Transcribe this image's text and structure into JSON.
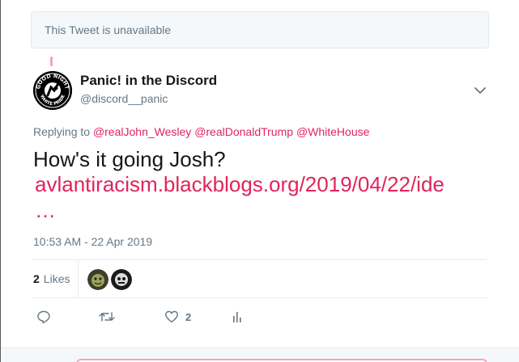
{
  "unavailable_notice": "This Tweet is unavailable",
  "author": {
    "name": "Panic! in the Discord",
    "handle": "@discord__panic",
    "avatar_icon": "good-night-white-pride-logo",
    "avatar_text_top": "GOOD NIGHT",
    "avatar_text_bottom": "WHITE PRIDE"
  },
  "replying": {
    "prefix": "Replying to",
    "mentions": [
      "@realJohn_Wesley",
      "@realDonaldTrump",
      "@WhiteHouse"
    ]
  },
  "tweet": {
    "text": "How's it going Josh?",
    "link": "avlantiracism.blackblogs.org/2019/04/22/ide",
    "ellipsis": "…"
  },
  "timestamp": "10:53 AM - 22 Apr 2019",
  "stats": {
    "likes_count": "2",
    "likes_label": "Likes"
  },
  "actions": {
    "reply_icon": "reply-icon",
    "retweet_icon": "retweet-icon",
    "like_icon": "heart-icon",
    "like_count": "2",
    "analytics_icon": "analytics-icon"
  },
  "colors": {
    "accent": "#e0245e",
    "muted": "#657786",
    "text": "#14171a",
    "border": "#e6ecf0"
  }
}
